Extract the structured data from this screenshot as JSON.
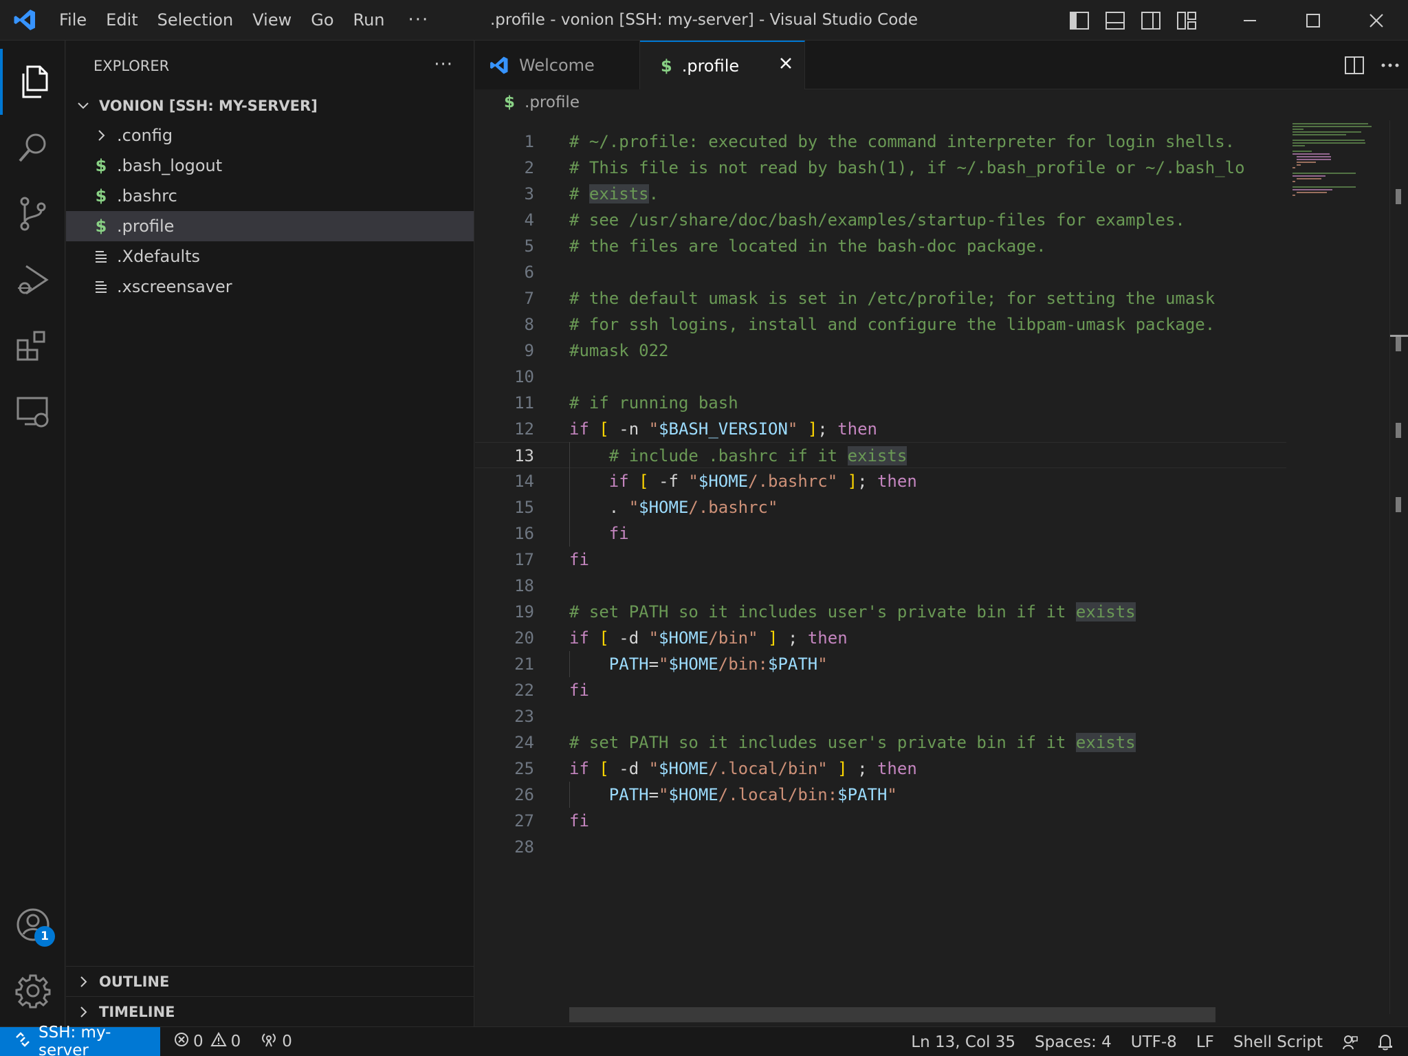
{
  "window": {
    "title": ".profile - vonion [SSH: my-server] - Visual Studio Code"
  },
  "menu": [
    "File",
    "Edit",
    "Selection",
    "View",
    "Go",
    "Run",
    "···"
  ],
  "sidebar": {
    "title": "EXPLORER",
    "more": "···",
    "folder": "VONION [SSH: MY-SERVER]",
    "items": [
      {
        "label": ".config",
        "icon": "chevron-right-icon"
      },
      {
        "label": ".bash_logout",
        "icon": "shell-file-icon"
      },
      {
        "label": ".bashrc",
        "icon": "shell-file-icon"
      },
      {
        "label": ".profile",
        "icon": "shell-file-icon",
        "selected": true
      },
      {
        "label": ".Xdefaults",
        "icon": "text-file-icon"
      },
      {
        "label": ".xscreensaver",
        "icon": "text-file-icon"
      }
    ],
    "outline": "OUTLINE",
    "timeline": "TIMELINE"
  },
  "tabs": [
    {
      "label": "Welcome",
      "active": false
    },
    {
      "label": ".profile",
      "active": true
    }
  ],
  "breadcrumb": ".profile",
  "editor": {
    "current_line": 13,
    "lines": [
      "# ~/.profile: executed by the command interpreter for login shells.",
      "# This file is not read by bash(1), if ~/.bash_profile or ~/.bash_lo",
      "# exists.",
      "# see /usr/share/doc/bash/examples/startup-files for examples.",
      "# the files are located in the bash-doc package.",
      "",
      "# the default umask is set in /etc/profile; for setting the umask",
      "# for ssh logins, install and configure the libpam-umask package.",
      "#umask 022",
      "",
      "# if running bash",
      "if [ -n \"$BASH_VERSION\" ]; then",
      "    # include .bashrc if it exists",
      "    if [ -f \"$HOME/.bashrc\" ]; then",
      "    . \"$HOME/.bashrc\"",
      "    fi",
      "fi",
      "",
      "# set PATH so it includes user's private bin if it exists",
      "if [ -d \"$HOME/bin\" ] ; then",
      "    PATH=\"$HOME/bin:$PATH\"",
      "fi",
      "",
      "# set PATH so it includes user's private bin if it exists",
      "if [ -d \"$HOME/.local/bin\" ] ; then",
      "    PATH=\"$HOME/.local/bin:$PATH\"",
      "fi",
      ""
    ]
  },
  "activity": {
    "accounts_badge": "1"
  },
  "status": {
    "remote": "SSH: my-server",
    "errors": "0",
    "warnings": "0",
    "ports": "0",
    "position": "Ln 13, Col 35",
    "spaces": "Spaces: 4",
    "encoding": "UTF-8",
    "eol": "LF",
    "language": "Shell Script"
  },
  "colors": {
    "accent": "#0078d4",
    "comment": "#6a9955",
    "keyword": "#c586c0",
    "string": "#ce9178",
    "variable": "#9cdcfe",
    "bracket": "#ffd700"
  }
}
